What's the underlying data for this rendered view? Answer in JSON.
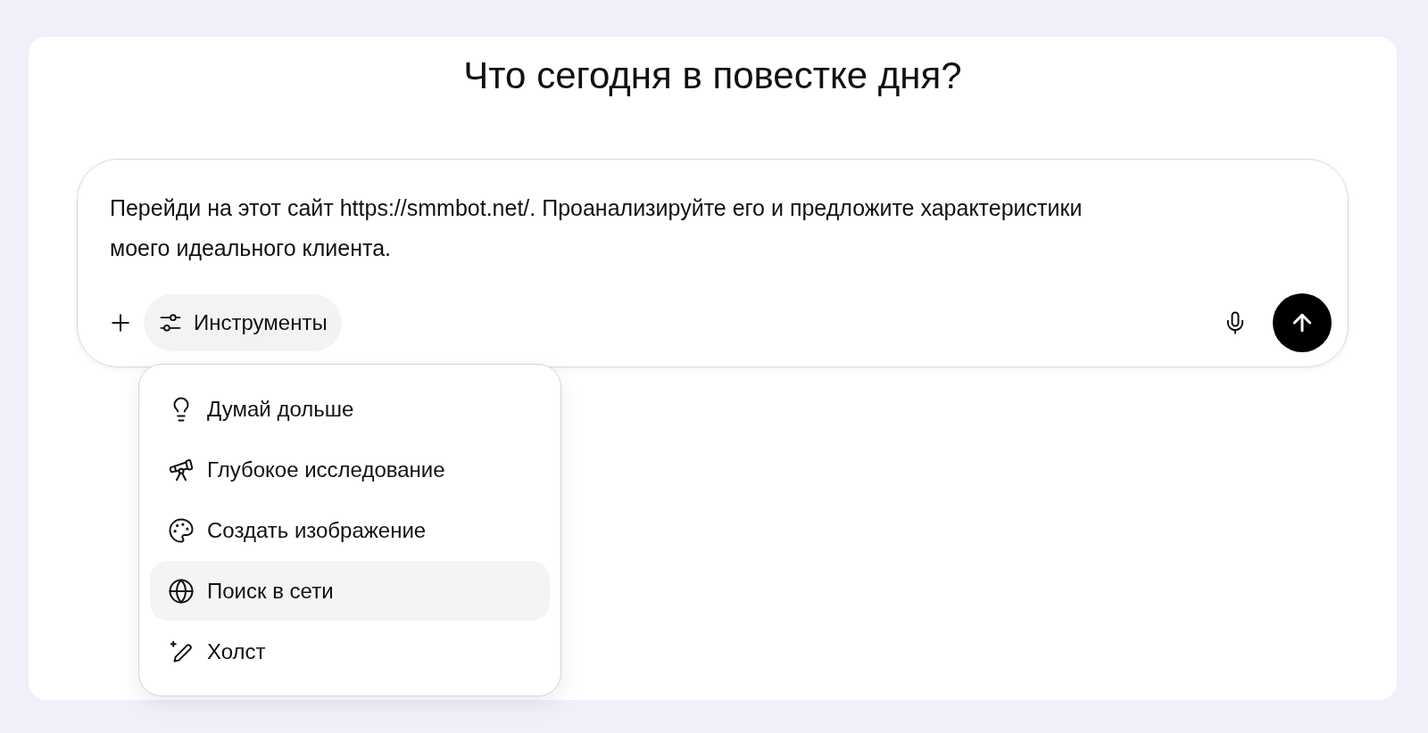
{
  "heading": "Что сегодня в повестке дня?",
  "composer": {
    "value": "Перейди на этот сайт https://smmbot.net/. Проанализируйте его и предложите характеристики моего идеального клиента.",
    "tools_button": {
      "label": "Инструменты",
      "open": true
    }
  },
  "tools_menu": [
    {
      "label": "Думай дольше",
      "selected": false
    },
    {
      "label": "Глубокое исследование",
      "selected": false
    },
    {
      "label": "Создать изображение",
      "selected": false
    },
    {
      "label": "Поиск в сети",
      "selected": true
    },
    {
      "label": "Холст",
      "selected": false
    }
  ]
}
